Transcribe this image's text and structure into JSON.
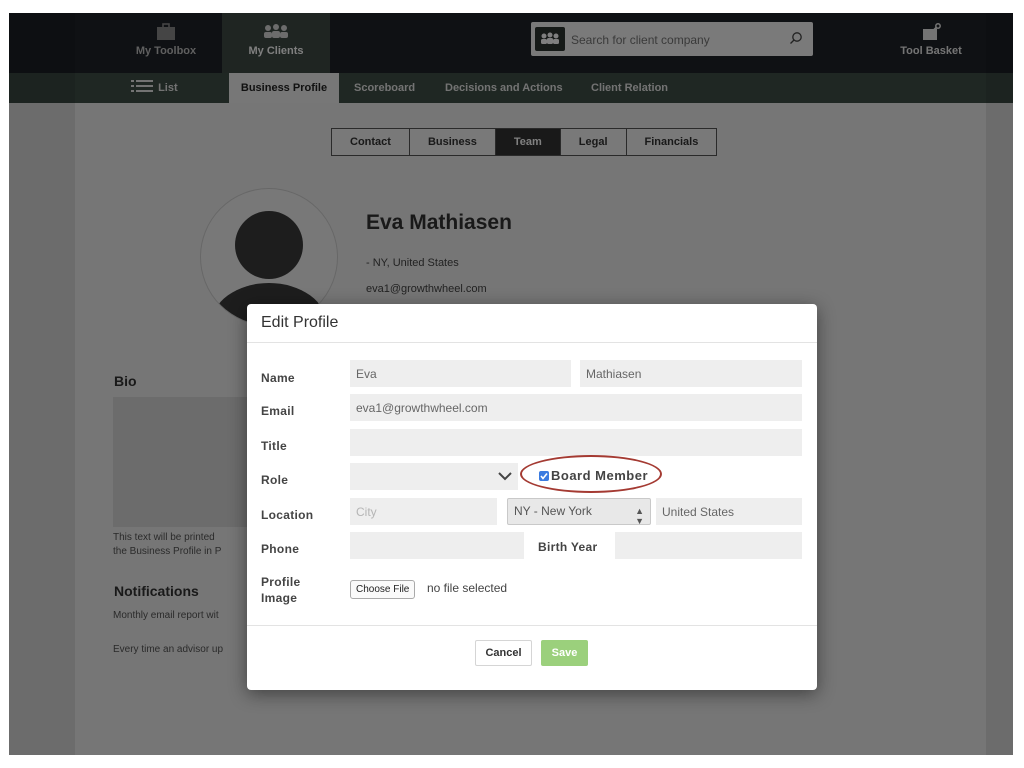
{
  "topbar": {
    "my_toolbox": "My Toolbox",
    "my_clients": "My Clients",
    "tool_basket": "Tool Basket",
    "search_placeholder": "Search for client company",
    "icons": {
      "toolbox": "toolbox-icon",
      "clients": "people-group-icon",
      "search": "search-icon",
      "basket": "tool-basket-icon"
    }
  },
  "subnav": {
    "list": "List",
    "items": [
      "Business Profile",
      "Scoreboard",
      "Decisions and Actions",
      "Client Relation"
    ],
    "active": "Business Profile"
  },
  "tabs": {
    "items": [
      "Contact",
      "Business",
      "Team",
      "Legal",
      "Financials"
    ],
    "active": "Team"
  },
  "profile": {
    "name": "Eva Mathiasen",
    "location": "- NY, United States",
    "email": "eva1@growthwheel.com"
  },
  "bio": {
    "heading": "Bio",
    "text_line1": "This text will be printed",
    "text_line2": "the Business Profile in P"
  },
  "notifications": {
    "heading": "Notifications",
    "line1": "Monthly email report wit",
    "line2": "Every time an advisor up"
  },
  "modal": {
    "title": "Edit Profile",
    "labels": {
      "name": "Name",
      "email": "Email",
      "title": "Title",
      "role": "Role",
      "location": "Location",
      "phone": "Phone",
      "birth_year": "Birth Year",
      "profile_image_1": "Profile",
      "profile_image_2": "Image"
    },
    "values": {
      "first_name": "Eva",
      "last_name": "Mathiasen",
      "email": "eva1@growthwheel.com",
      "title": "",
      "role": "",
      "city_placeholder": "City",
      "state": "NY - New York",
      "country": "United States",
      "phone": "",
      "birth_year": ""
    },
    "board_member": {
      "label": "Board Member",
      "checked": true
    },
    "choose_file": "Choose File",
    "no_file": "no file selected",
    "cancel": "Cancel",
    "save": "Save"
  },
  "colors": {
    "topbar": "#1f2328",
    "subnav": "#3f4f46",
    "save": "#9bd07c",
    "highlight_ring": "#a43a32",
    "checkbox": "#3b7be0"
  }
}
